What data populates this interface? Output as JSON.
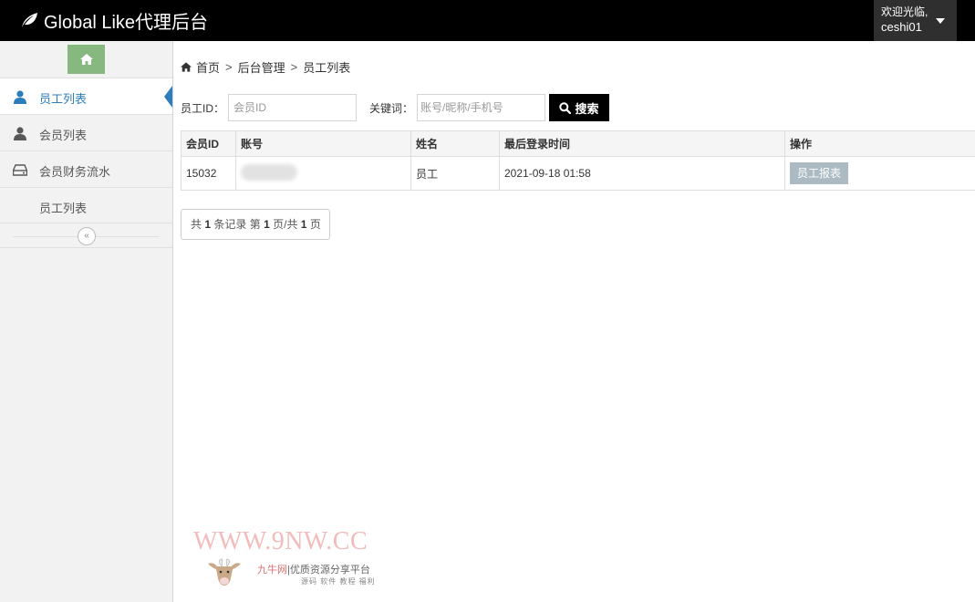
{
  "header": {
    "brand": "Global Like代理后台",
    "greeting": "欢迎光临,",
    "username": "ceshi01"
  },
  "sidebar": {
    "items": [
      {
        "label": "员工列表",
        "icon": "user-icon",
        "active": true
      },
      {
        "label": "会员列表",
        "icon": "user-icon",
        "active": false
      },
      {
        "label": "会员财务流水",
        "icon": "hdd-icon",
        "active": false
      },
      {
        "label": "员工列表",
        "icon": "",
        "active": false
      }
    ],
    "collapse_glyph": "«"
  },
  "breadcrumb": {
    "items": [
      "首页",
      "后台管理",
      "员工列表"
    ],
    "separator": ">"
  },
  "search": {
    "id_label": "员工ID：",
    "id_placeholder": "会员ID",
    "keyword_label": "关键词：",
    "keyword_placeholder": "账号/昵称/手机号",
    "button_label": "搜索"
  },
  "table": {
    "columns": [
      "会员ID",
      "账号",
      "姓名",
      "最后登录时间",
      "操作"
    ],
    "rows": [
      {
        "id": "15032",
        "account": "",
        "name": "员工",
        "last_login": "2021-09-18 01:58",
        "action": "员工报表"
      }
    ]
  },
  "pagination": {
    "prefix": "共",
    "total": "1",
    "records_text": "条记录 第",
    "page": "1",
    "page_of": "页/共",
    "pages": "1",
    "suffix": "页"
  },
  "watermark": {
    "url": "WWW.9NW.CC",
    "brand": "九牛网",
    "tagline": "优质资源分享平台",
    "tags": "源码 软件 教程 福利"
  },
  "colors": {
    "topbar": "#000000",
    "home_button": "#87b87f",
    "active_accent": "#2b7dbc",
    "search_button": "#000000",
    "report_button": "#abbac3"
  }
}
